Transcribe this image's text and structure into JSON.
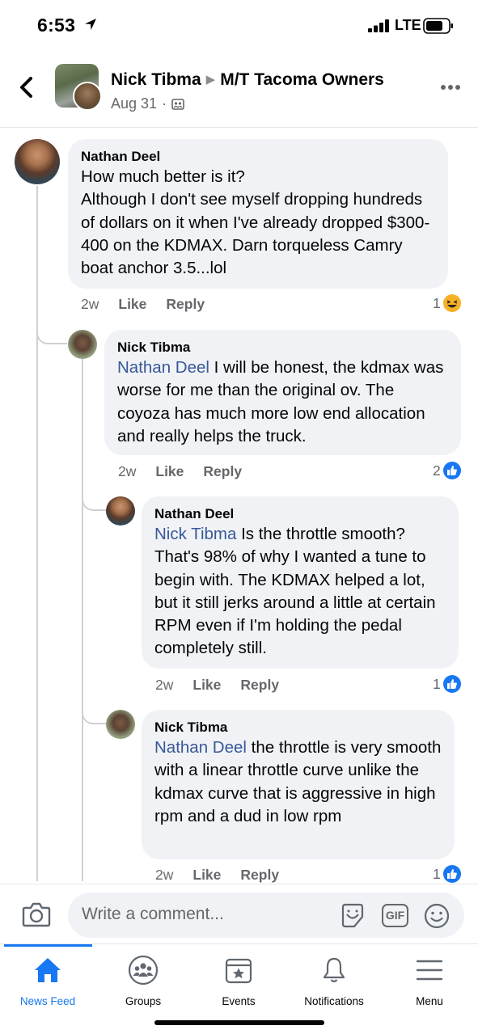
{
  "status_bar": {
    "time": "6:53",
    "network": "LTE"
  },
  "header": {
    "author": "Nick Tibma",
    "group": "M/T Tacoma Owners",
    "date": "Aug 31",
    "separator": "·"
  },
  "comments": [
    {
      "author": "Nathan Deel",
      "mention": "",
      "text": "How much better is it?\nAlthough I don't see myself dropping hundreds of dollars on it when I've already dropped $300-400 on the KDMAX. Darn torqueless Camry boat anchor 3.5...lol",
      "time": "2w",
      "like_label": "Like",
      "reply_label": "Reply",
      "reaction_count": "1",
      "reaction": "haha-icon"
    },
    {
      "author": "Nick Tibma",
      "mention": "Nathan Deel",
      "text": " I will be honest, the kdmax was worse for me than the original ov. The coyoza has much more low end allocation and really helps the truck.",
      "time": "2w",
      "like_label": "Like",
      "reply_label": "Reply",
      "reaction_count": "2",
      "reaction": "like-icon"
    },
    {
      "author": "Nathan Deel",
      "mention": "Nick Tibma",
      "text": " Is the throttle smooth? That's 98% of why I wanted a tune to begin with. The KDMAX helped a lot, but it still jerks around a little at certain RPM even if I'm holding the pedal completely still.",
      "time": "2w",
      "like_label": "Like",
      "reply_label": "Reply",
      "reaction_count": "1",
      "reaction": "like-icon"
    },
    {
      "author": "Nick Tibma",
      "mention": "Nathan Deel",
      "text": " the throttle is very smooth with a linear throttle curve unlike the kdmax curve that is aggressive in high rpm and a dud in low rpm",
      "time": "2w",
      "like_label": "Like",
      "reply_label": "Reply",
      "reaction_count": "1",
      "reaction": "like-icon"
    }
  ],
  "composer": {
    "placeholder": "Write a comment...",
    "gif_label": "GIF"
  },
  "tabs": [
    {
      "label": "News Feed",
      "icon": "home-icon",
      "active": true
    },
    {
      "label": "Groups",
      "icon": "groups-icon",
      "active": false
    },
    {
      "label": "Events",
      "icon": "events-icon",
      "active": false
    },
    {
      "label": "Notifications",
      "icon": "bell-icon",
      "active": false
    },
    {
      "label": "Menu",
      "icon": "menu-icon",
      "active": false
    }
  ],
  "colors": {
    "accent": "#1877f2",
    "mention": "#385898",
    "bubble": "#f0f2f5",
    "muted": "#65676b"
  }
}
